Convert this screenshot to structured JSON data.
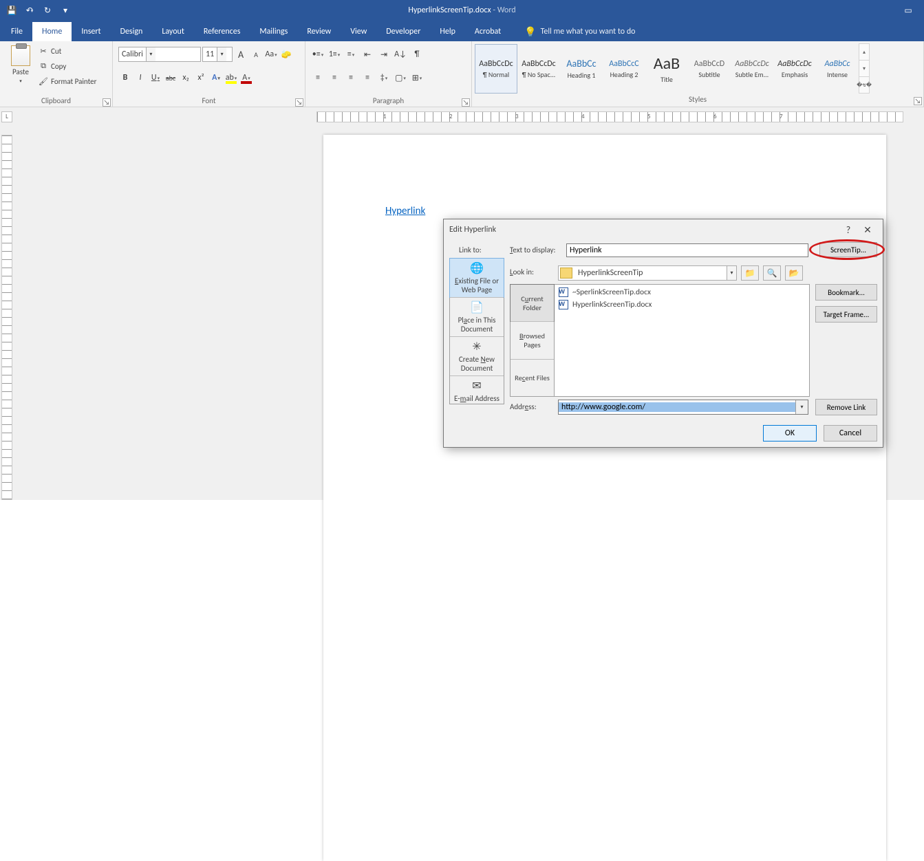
{
  "title": {
    "doc": "HyperlinkScreenTip.docx",
    "app": "Word"
  },
  "qat": {
    "save": "💾",
    "undo": "↶",
    "redo": "↻",
    "customize": "▾"
  },
  "tabs": {
    "file": "File",
    "home": "Home",
    "insert": "Insert",
    "design": "Design",
    "layout": "Layout",
    "references": "References",
    "mailings": "Mailings",
    "review": "Review",
    "view": "View",
    "developer": "Developer",
    "help": "Help",
    "acrobat": "Acrobat",
    "tellme": "Tell me what you want to do"
  },
  "clipboard": {
    "paste": "Paste",
    "cut": "Cut",
    "copy": "Copy",
    "formatpainter": "Format Painter",
    "label": "Clipboard"
  },
  "font": {
    "name": "Calibri",
    "size": "11",
    "label": "Font",
    "grow": "A",
    "shrink": "A",
    "case": "Aa",
    "clear": "🧽",
    "bold": "B",
    "italic": "I",
    "underline": "U",
    "strike": "abc",
    "sub": "x₂",
    "sup": "x²",
    "effects": "A",
    "highlight": "ab",
    "color": "A"
  },
  "paragraph": {
    "label": "Paragraph"
  },
  "stylesg": {
    "label": "Styles",
    "items": [
      {
        "preview": "AaBbCcDc",
        "name": "¶ Normal"
      },
      {
        "preview": "AaBbCcDc",
        "name": "¶ No Spac..."
      },
      {
        "preview": "AaBbCc",
        "name": "Heading 1"
      },
      {
        "preview": "AaBbCcC",
        "name": "Heading 2"
      },
      {
        "preview": "AaB",
        "name": "Title"
      },
      {
        "preview": "AaBbCcD",
        "name": "Subtitle"
      },
      {
        "preview": "AaBbCcDc",
        "name": "Subtle Em..."
      },
      {
        "preview": "AaBbCcDc",
        "name": "Emphasis"
      },
      {
        "preview": "AaBbCc",
        "name": "Intense"
      }
    ]
  },
  "ruler": {
    "nums": [
      "1",
      "2",
      "3",
      "4",
      "5",
      "6",
      "7"
    ]
  },
  "doc": {
    "hyperlink": "Hyperlink"
  },
  "dialog": {
    "title": "Edit Hyperlink",
    "help": "?",
    "close": "✕",
    "linkto_label": "Link to:",
    "linkto": [
      {
        "icon": "🌐",
        "label": "Existing File or Web Page"
      },
      {
        "icon": "📄",
        "label": "Place in This Document"
      },
      {
        "icon": "✳",
        "label": "Create New Document"
      },
      {
        "icon": "✉",
        "label": "E-mail Address"
      }
    ],
    "text_label": "Text to display:",
    "text_value": "Hyperlink",
    "screentip": "ScreenTip...",
    "lookin_label": "Look in:",
    "lookin_value": "HyperlinkScreenTip",
    "mid_tabs": [
      "Current Folder",
      "Browsed Pages",
      "Recent Files"
    ],
    "files": [
      "~SperlinkScreenTip.docx",
      "HyperlinkScreenTip.docx"
    ],
    "bookmark": "Bookmark...",
    "targetframe": "Target Frame...",
    "address_label": "Address:",
    "address_value": "http://www.google.com/",
    "remove": "Remove Link",
    "ok": "OK",
    "cancel": "Cancel"
  }
}
